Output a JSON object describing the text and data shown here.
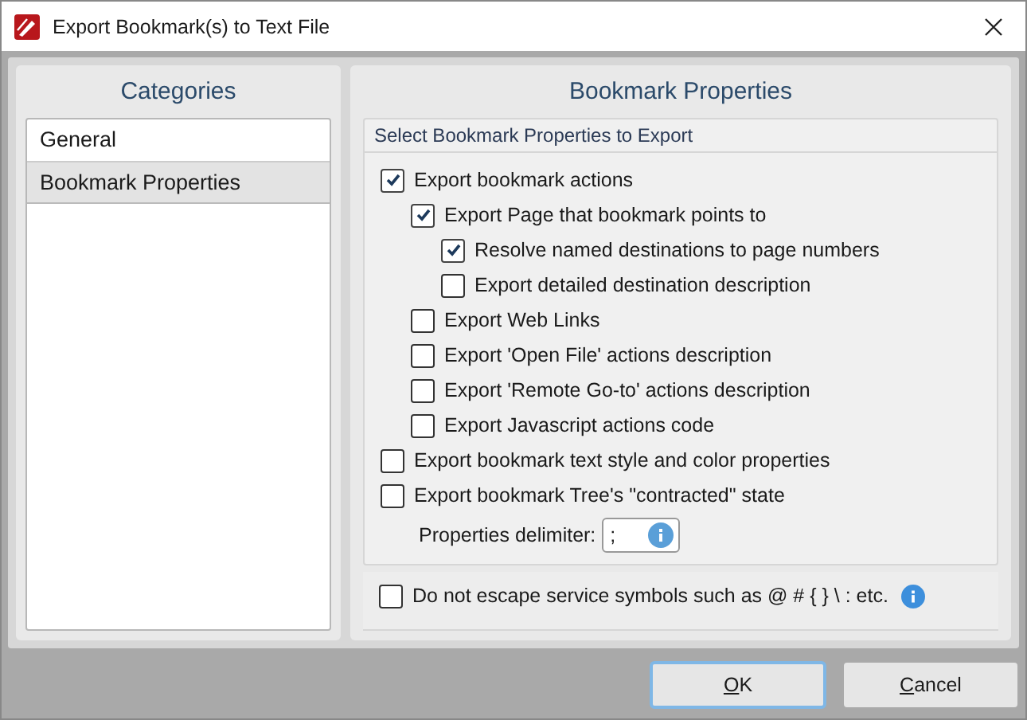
{
  "window": {
    "title": "Export Bookmark(s) to Text File"
  },
  "categories": {
    "title": "Categories",
    "items": [
      {
        "label": "General",
        "selected": false
      },
      {
        "label": "Bookmark Properties",
        "selected": true
      }
    ]
  },
  "properties": {
    "title": "Bookmark Properties",
    "group_title": "Select Bookmark Properties to Export",
    "options": [
      {
        "label": "Export bookmark actions",
        "checked": true,
        "children": [
          {
            "label": "Export Page that bookmark points to",
            "checked": true,
            "children": [
              {
                "label": "Resolve named destinations to page numbers",
                "checked": true
              },
              {
                "label": "Export detailed destination description",
                "checked": false
              }
            ]
          },
          {
            "label": "Export Web Links",
            "checked": false
          },
          {
            "label": "Export 'Open File' actions description",
            "checked": false
          },
          {
            "label": "Export 'Remote Go-to' actions description",
            "checked": false
          },
          {
            "label": "Export Javascript actions code",
            "checked": false
          }
        ]
      },
      {
        "label": "Export bookmark text style and color properties",
        "checked": false
      },
      {
        "label": "Export bookmark Tree's \"contracted\" state",
        "checked": false
      }
    ],
    "delimiter": {
      "label": "Properties delimiter:",
      "value": ";"
    },
    "escape_option": {
      "label": "Do not escape service symbols such as @ # { } \\ : etc.",
      "checked": false
    }
  },
  "buttons": [
    {
      "label": "OK",
      "default": true
    },
    {
      "label": "Cancel",
      "default": false
    }
  ]
}
